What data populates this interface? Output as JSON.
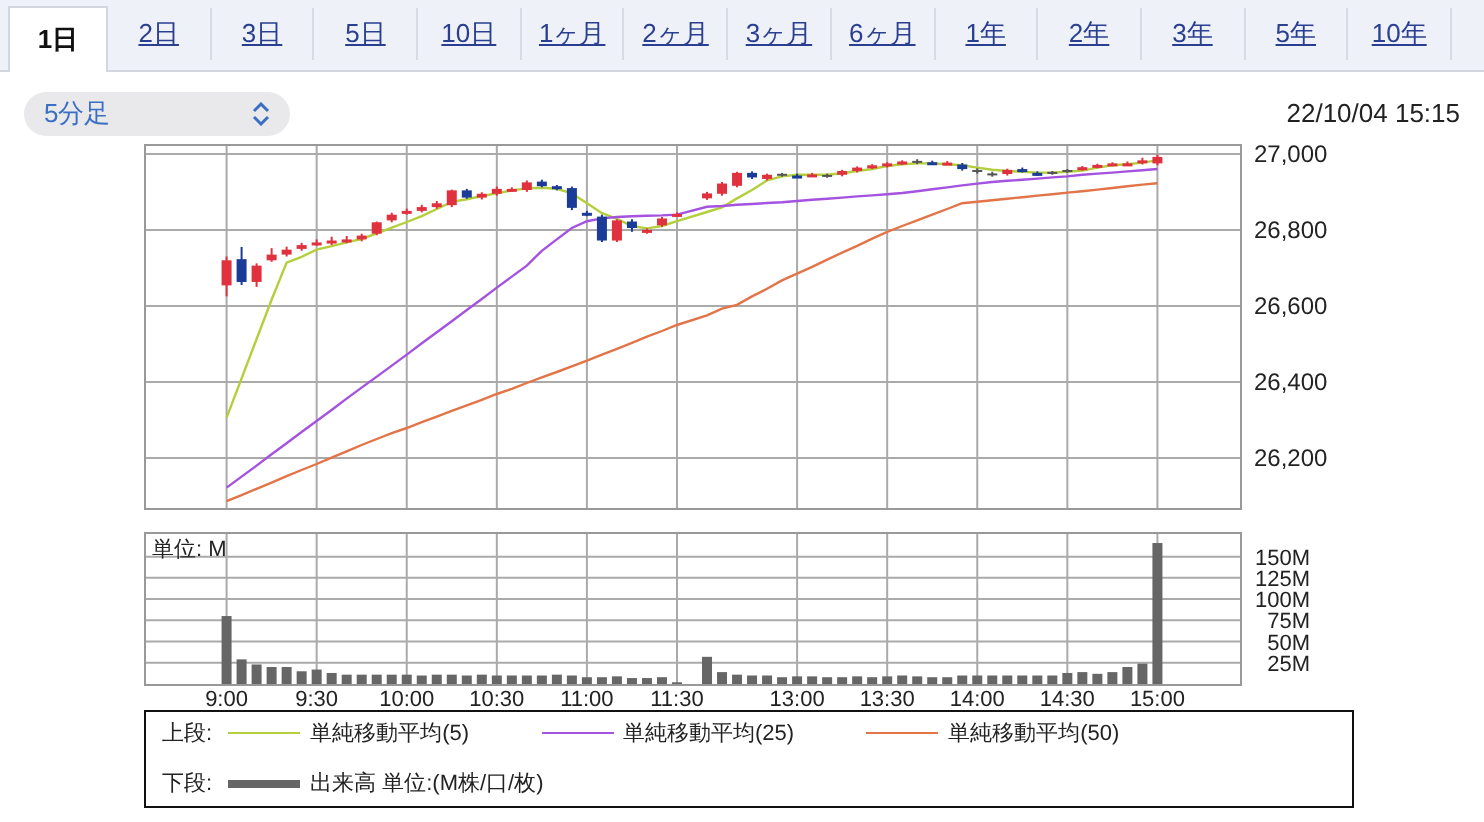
{
  "tabs": [
    {
      "label": "1日",
      "selected": true
    },
    {
      "label": "2日",
      "selected": false
    },
    {
      "label": "3日",
      "selected": false
    },
    {
      "label": "5日",
      "selected": false
    },
    {
      "label": "10日",
      "selected": false
    },
    {
      "label": "1ヶ月",
      "selected": false
    },
    {
      "label": "2ヶ月",
      "selected": false
    },
    {
      "label": "3ヶ月",
      "selected": false
    },
    {
      "label": "6ヶ月",
      "selected": false
    },
    {
      "label": "1年",
      "selected": false
    },
    {
      "label": "2年",
      "selected": false
    },
    {
      "label": "3年",
      "selected": false
    },
    {
      "label": "5年",
      "selected": false
    },
    {
      "label": "10年",
      "selected": false
    }
  ],
  "interval_select": {
    "value": "5分足"
  },
  "timestamp": "22/10/04 15:15",
  "price_chart": {
    "chart_data": {
      "type": "line",
      "grid": true,
      "ylim": [
        26063,
        27026
      ],
      "categories": [
        null,
        null,
        null,
        null,
        null,
        null,
        null,
        null,
        null,
        null,
        null,
        null,
        null,
        null,
        null,
        null,
        null,
        null,
        null,
        null,
        null,
        null,
        null,
        null,
        null,
        null,
        null,
        null,
        null,
        null,
        null,
        null,
        null,
        null,
        null,
        null,
        null,
        null,
        null,
        null,
        null,
        null,
        null,
        null,
        null,
        null,
        null,
        null,
        null,
        null,
        null,
        null,
        null,
        null,
        null,
        null,
        null,
        null,
        null,
        null,
        null,
        null,
        null,
        null,
        null,
        null,
        null,
        null,
        null,
        null,
        null,
        null,
        null
      ],
      "yticks": [
        {
          "value": 26200,
          "label": "26,200"
        },
        {
          "value": 26400,
          "label": "26,400"
        },
        {
          "value": 26600,
          "label": "26,600"
        },
        {
          "value": 26800,
          "label": "26,800"
        },
        {
          "value": 27000,
          "label": "27,000"
        }
      ],
      "series": [
        {
          "name": "単純移動平均(5)",
          "color": "#b4cf3c",
          "values": [
            null,
            null,
            null,
            null,
            null,
            26306,
            26409,
            26513,
            26616,
            26714,
            26729,
            26748,
            26757,
            26767,
            26776,
            26791,
            26806,
            26821,
            26836,
            26855,
            26874,
            26881,
            26889,
            26896,
            26904,
            26909,
            26911,
            26908,
            26896,
            26870,
            26844,
            26829,
            26810,
            26804,
            26810,
            26823,
            null,
            26847,
            26859,
            26883,
            26905,
            26930,
            26941,
            26945,
            26945,
            26945,
            26949,
            26955,
            26960,
            26968,
            26973,
            26975,
            26975,
            26973,
            26970,
            26964,
            26958,
            26955,
            26953,
            26951,
            26951,
            26953,
            26956,
            26964,
            26970,
            26973,
            26977,
            26983,
            null,
            null,
            null,
            null,
            null
          ]
        },
        {
          "name": "単純移動平均(25)",
          "color": "#a452e0",
          "values": [
            null,
            null,
            null,
            null,
            null,
            26122,
            26151,
            26180,
            26210,
            26239,
            26268,
            26297,
            26326,
            26356,
            26385,
            26414,
            26443,
            26472,
            26502,
            26531,
            26560,
            26589,
            26618,
            26648,
            26677,
            26706,
            26745,
            26775,
            26805,
            26823,
            26830,
            26834,
            26836,
            26837,
            26838,
            26840,
            null,
            26861,
            26863,
            26866,
            26868,
            26871,
            26873,
            26876,
            26879,
            26882,
            26885,
            26888,
            26891,
            26894,
            26897,
            26902,
            26907,
            26912,
            26917,
            26922,
            26926,
            26929,
            26932,
            26935,
            26938,
            26941,
            26945,
            26948,
            26951,
            26954,
            26957,
            26960,
            null,
            null,
            null,
            null,
            null
          ]
        },
        {
          "name": "単純移動平均(50)",
          "color": "#e27448",
          "values": [
            null,
            null,
            null,
            null,
            null,
            26086,
            26102,
            26119,
            26135,
            26152,
            26168,
            26184,
            26201,
            26217,
            26234,
            26250,
            26265,
            26279,
            26294,
            26309,
            26324,
            26338,
            26353,
            26368,
            26382,
            26397,
            26412,
            26426,
            26441,
            26456,
            26472,
            26487,
            26503,
            26519,
            26534,
            26550,
            null,
            26575,
            26593,
            26603,
            26625,
            26645,
            26667,
            26685,
            26703,
            26722,
            26740,
            26758,
            26777,
            26795,
            26810,
            26825,
            26840,
            26855,
            26870,
            26874,
            26878,
            26882,
            26886,
            26890,
            26894,
            26898,
            26902,
            26906,
            26910,
            26915,
            26919,
            26923,
            null,
            null,
            null,
            null,
            null
          ]
        },
        {
          "type": "candlestick",
          "ohlc": [
            null,
            null,
            null,
            null,
            null,
            [
              26654,
              26730,
              26625,
              26720
            ],
            [
              26723,
              26755,
              26655,
              26663
            ],
            [
              26663,
              26712,
              26650,
              26706
            ],
            [
              26720,
              26752,
              26716,
              26735
            ],
            [
              26735,
              26756,
              26730,
              26748
            ],
            [
              26750,
              26766,
              26745,
              26760
            ],
            [
              26763,
              26775,
              26758,
              26767
            ],
            [
              26770,
              26782,
              26760,
              26772
            ],
            [
              26772,
              26784,
              26765,
              26775
            ],
            [
              26775,
              26790,
              26770,
              26785
            ],
            [
              26790,
              26822,
              26786,
              26820
            ],
            [
              26825,
              26845,
              26820,
              26840
            ],
            [
              26845,
              26856,
              26840,
              26850
            ],
            [
              26850,
              26866,
              26846,
              26860
            ],
            [
              26860,
              26876,
              26856,
              26870
            ],
            [
              26865,
              26906,
              26860,
              26904
            ],
            [
              26904,
              26908,
              26882,
              26885
            ],
            [
              26885,
              26899,
              26880,
              26895
            ],
            [
              26895,
              26914,
              26890,
              26908
            ],
            [
              26905,
              26912,
              26900,
              26908
            ],
            [
              26905,
              26930,
              26900,
              26925
            ],
            [
              26927,
              26932,
              26912,
              26915
            ],
            [
              26915,
              26918,
              26904,
              26908
            ],
            [
              26910,
              26914,
              26852,
              26858
            ],
            [
              26845,
              26850,
              26836,
              26842
            ],
            [
              26835,
              26840,
              26768,
              26772
            ],
            [
              26772,
              26828,
              26768,
              26825
            ],
            [
              26822,
              26828,
              26795,
              26805
            ],
            [
              26795,
              26804,
              26790,
              26800
            ],
            [
              26812,
              26834,
              26808,
              26830
            ],
            [
              26838,
              26846,
              26834,
              26842
            ],
            null,
            [
              26883,
              26900,
              26879,
              26896
            ],
            [
              26895,
              26926,
              26890,
              26922
            ],
            [
              26916,
              26953,
              26912,
              26950
            ],
            [
              26950,
              26954,
              26934,
              26938
            ],
            [
              26934,
              26948,
              26930,
              26945
            ],
            [
              26945,
              26950,
              26940,
              26945
            ],
            [
              26943,
              26948,
              26938,
              26942
            ],
            [
              26945,
              26950,
              26940,
              26946
            ],
            [
              26942,
              26948,
              26937,
              26942
            ],
            [
              26945,
              26958,
              26941,
              26955
            ],
            [
              26955,
              26967,
              26951,
              26964
            ],
            [
              26964,
              26973,
              26960,
              26970
            ],
            [
              26968,
              26978,
              26964,
              26975
            ],
            [
              26975,
              26983,
              26971,
              26980
            ],
            [
              26979,
              26986,
              26973,
              26979
            ],
            [
              26978,
              26982,
              26971,
              26975
            ],
            [
              26975,
              26981,
              26971,
              26977
            ],
            [
              26972,
              26976,
              26956,
              26960
            ],
            [
              26955,
              26962,
              26948,
              26955
            ],
            [
              26946,
              26953,
              26940,
              26946
            ],
            [
              26947,
              26961,
              26943,
              26958
            ],
            [
              26960,
              26964,
              26951,
              26955
            ],
            [
              26950,
              26954,
              26942,
              26946
            ],
            [
              26950,
              26955,
              26945,
              26950
            ],
            [
              26955,
              26960,
              26950,
              26955
            ],
            [
              26960,
              26968,
              26956,
              26965
            ],
            [
              26966,
              26974,
              26962,
              26971
            ],
            [
              26972,
              26978,
              26968,
              26975
            ],
            [
              26974,
              26980,
              26970,
              26975
            ],
            [
              26976,
              26990,
              26972,
              26983
            ],
            [
              26975,
              26998,
              26970,
              26992
            ],
            null,
            null,
            null,
            null,
            null
          ]
        }
      ]
    }
  },
  "volume_chart": {
    "unit_label": "単位: M",
    "chart_data": {
      "type": "bar",
      "grid": true,
      "ylim": [
        0,
        179
      ],
      "categories": [
        null,
        null,
        null,
        null,
        null,
        "9:00",
        null,
        null,
        null,
        null,
        null,
        "9:30",
        null,
        null,
        null,
        null,
        null,
        "10:00",
        null,
        null,
        null,
        null,
        null,
        "10:30",
        null,
        null,
        null,
        null,
        null,
        "11:00",
        null,
        null,
        null,
        null,
        null,
        "11:30",
        null,
        null,
        null,
        null,
        null,
        null,
        null,
        "13:00",
        null,
        null,
        null,
        null,
        null,
        "13:30",
        null,
        null,
        null,
        null,
        null,
        "14:00",
        null,
        null,
        null,
        null,
        null,
        "14:30",
        null,
        null,
        null,
        null,
        null,
        "15:00",
        null,
        null,
        null,
        null,
        null
      ],
      "yticks": [
        {
          "value": 25,
          "label": "25M"
        },
        {
          "value": 50,
          "label": "50M"
        },
        {
          "value": 75,
          "label": "75M"
        },
        {
          "value": 100,
          "label": "100M"
        },
        {
          "value": 125,
          "label": "125M"
        },
        {
          "value": 150,
          "label": "150M"
        }
      ],
      "series": [
        {
          "name": "出来高 単位:(M株/口/枚)",
          "color": "#666666",
          "values": [
            null,
            null,
            null,
            null,
            null,
            80,
            29,
            23,
            20,
            20,
            15,
            17,
            13,
            11,
            11,
            11,
            11,
            11,
            10,
            11,
            11,
            10,
            11,
            10,
            10,
            10,
            10,
            11,
            10,
            8,
            8,
            9,
            7,
            7,
            8,
            2,
            null,
            32,
            14,
            11,
            10,
            10,
            8,
            9,
            9,
            8,
            8,
            9,
            8,
            9,
            10,
            9,
            8,
            8,
            10,
            10,
            10,
            10,
            10,
            10,
            10,
            13,
            14,
            12,
            14,
            20,
            24,
            166,
            null,
            null,
            null,
            null,
            null
          ]
        }
      ]
    }
  },
  "legend": {
    "upper_label": "上段:",
    "lower_label": "下段:"
  }
}
